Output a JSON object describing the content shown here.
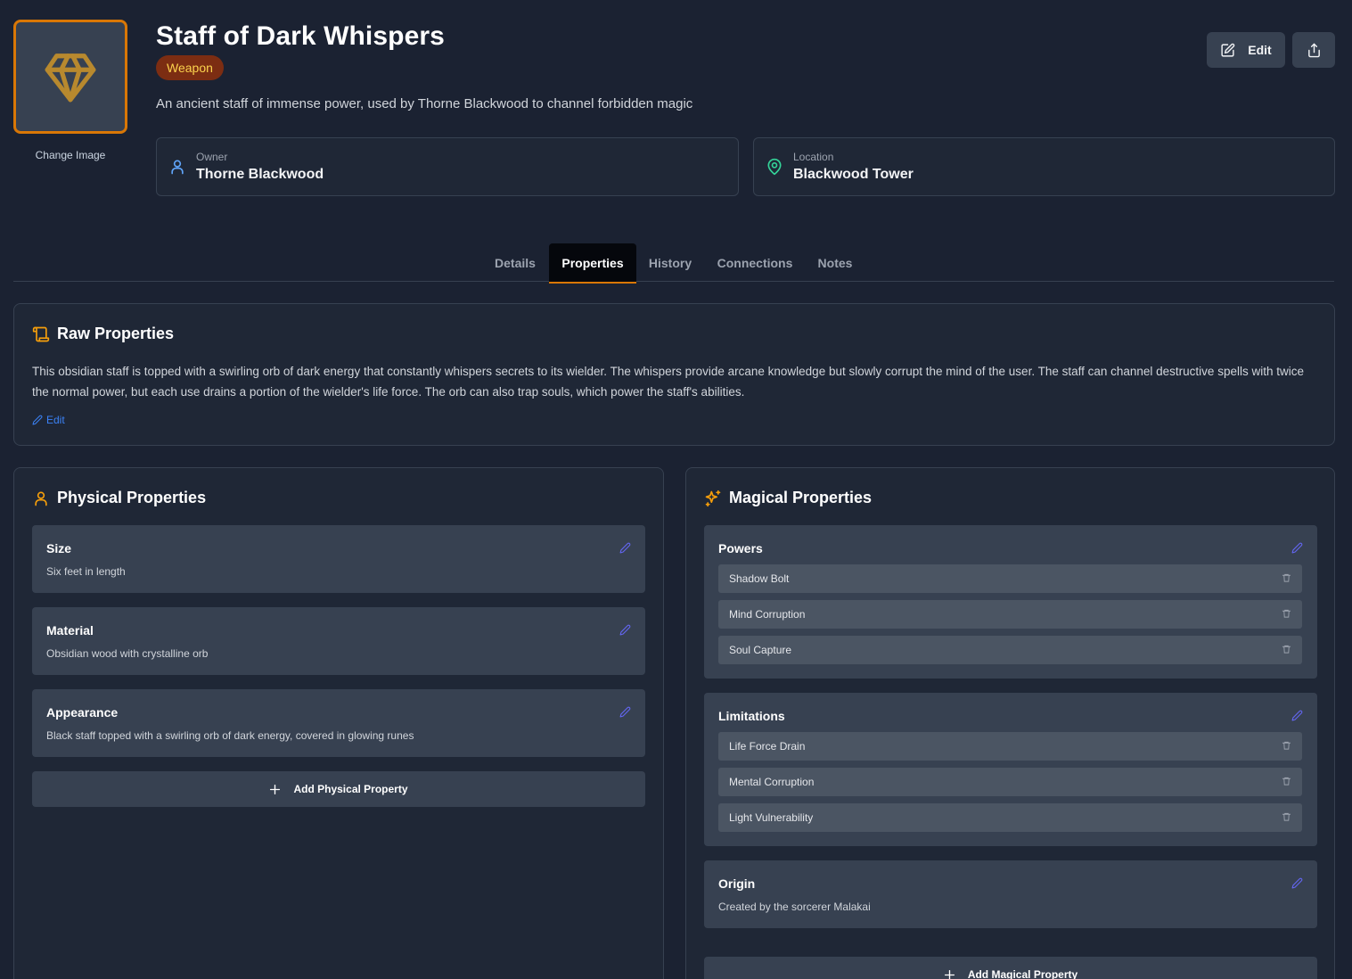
{
  "item": {
    "title": "Staff of Dark Whispers",
    "type_badge": "Weapon",
    "description": "An ancient staff of immense power, used by Thorne Blackwood to channel forbidden magic",
    "change_image_label": "Change Image",
    "image_icon": "gem-icon"
  },
  "info": {
    "owner_label": "Owner",
    "owner_value": "Thorne Blackwood",
    "location_label": "Location",
    "location_value": "Blackwood Tower"
  },
  "header_actions": {
    "edit_label": "Edit"
  },
  "tabs": [
    {
      "label": "Details",
      "active": false
    },
    {
      "label": "Properties",
      "active": true
    },
    {
      "label": "History",
      "active": false
    },
    {
      "label": "Connections",
      "active": false
    },
    {
      "label": "Notes",
      "active": false
    }
  ],
  "raw_properties": {
    "title": "Raw Properties",
    "text": "This obsidian staff is topped with a swirling orb of dark energy that constantly whispers secrets to its wielder. The whispers provide arcane knowledge but slowly corrupt the mind of the user. The staff can channel destructive spells with twice the normal power, but each use drains a portion of the wielder's life force. The orb can also trap souls, which power the staff's abilities.",
    "edit_label": "Edit"
  },
  "physical": {
    "title": "Physical Properties",
    "properties": [
      {
        "name": "Size",
        "value": "Six feet in length"
      },
      {
        "name": "Material",
        "value": "Obsidian wood with crystalline orb"
      },
      {
        "name": "Appearance",
        "value": "Black staff topped with a swirling orb of dark energy, covered in glowing runes"
      }
    ],
    "add_label": "Add Physical Property"
  },
  "magical": {
    "title": "Magical Properties",
    "powers": {
      "name": "Powers",
      "items": [
        "Shadow Bolt",
        "Mind Corruption",
        "Soul Capture"
      ]
    },
    "limitations": {
      "name": "Limitations",
      "items": [
        "Life Force Drain",
        "Mental Corruption",
        "Light Vulnerability"
      ]
    },
    "origin": {
      "name": "Origin",
      "value": "Created by the sorcerer Malakai"
    },
    "add_label": "Add Magical Property"
  },
  "colors": {
    "background": "#1b2232",
    "accent": "#d97706",
    "link": "#3b82f6",
    "owner_icon": "#60a5fa",
    "location_icon": "#34d399"
  }
}
